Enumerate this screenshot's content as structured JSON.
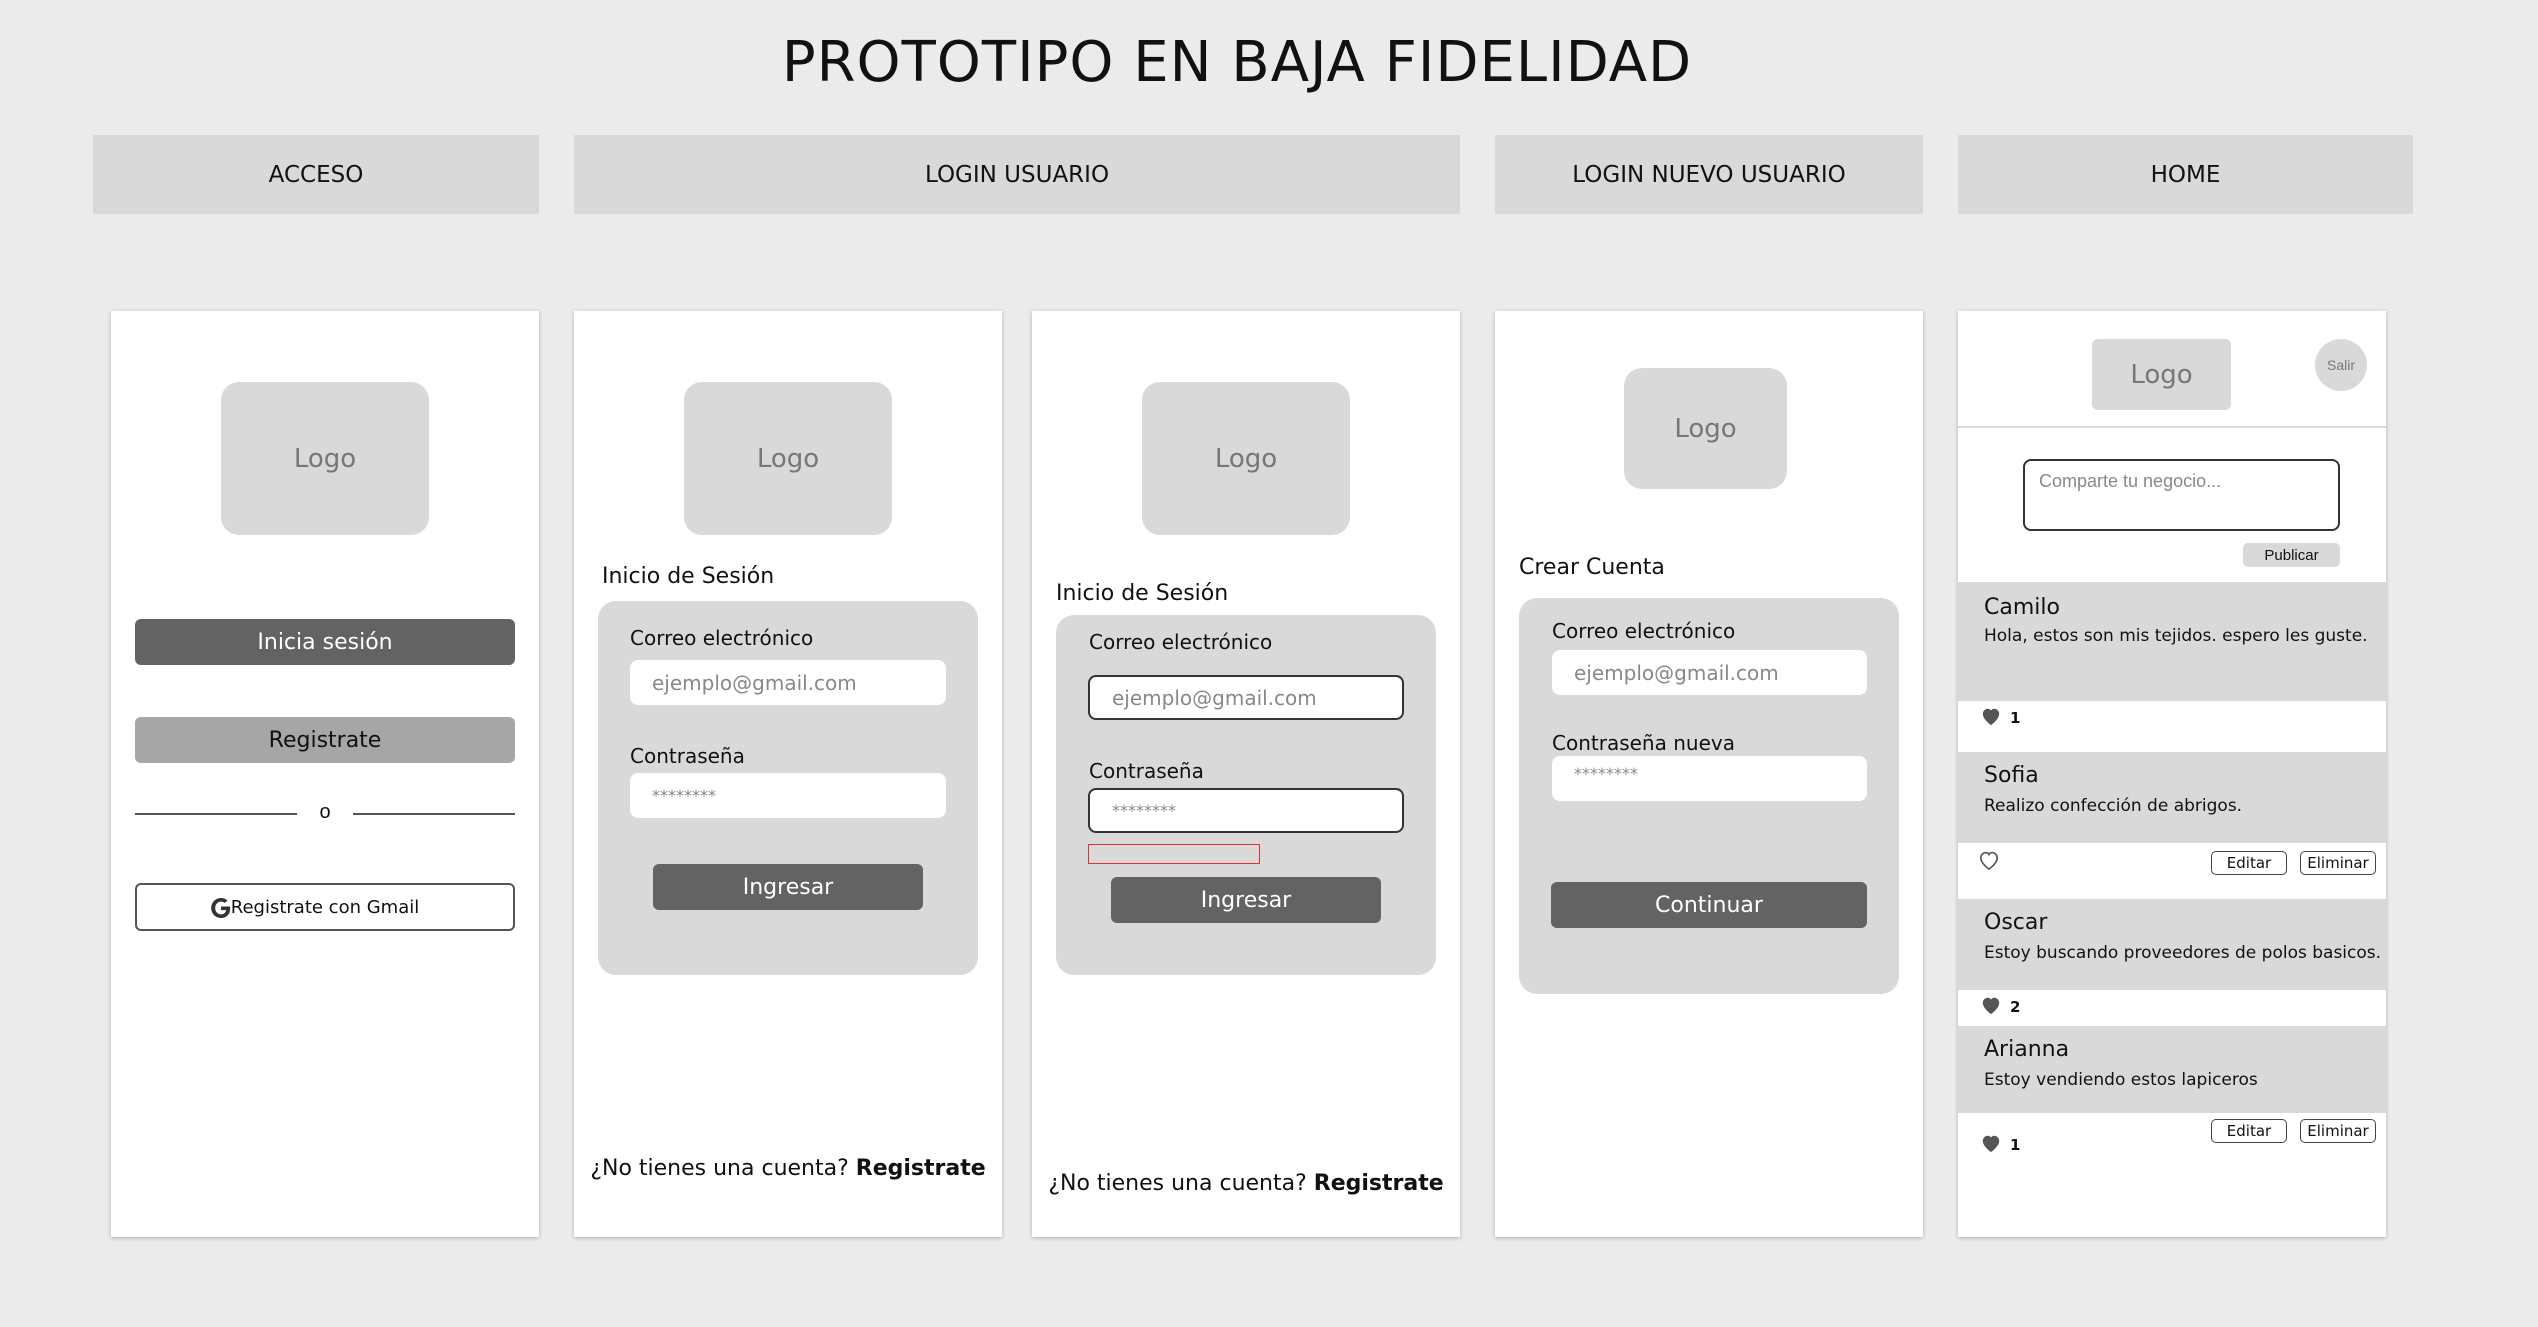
{
  "page": {
    "title": "PROTOTIPO EN BAJA FIDELIDAD"
  },
  "headers": [
    "ACCESO",
    "LOGIN USUARIO",
    "LOGIN NUEVO USUARIO",
    "HOME"
  ],
  "logo_label": "Logo",
  "acceso": {
    "login_button": "Inicia sesión",
    "register_button": "Registrate",
    "separator": "o",
    "gmail_button": "Registrate con Gmail"
  },
  "login": {
    "section_title": "Inicio de Sesión",
    "email_label": "Correo electrónico",
    "email_placeholder": "ejemplo@gmail.com",
    "password_label": "Contraseña",
    "password_value": "********",
    "submit": "Ingresar",
    "footer_question": "¿No tienes una cuenta?",
    "footer_link": "Registrate"
  },
  "signup": {
    "section_title": "Crear Cuenta",
    "email_label": "Correo electrónico",
    "email_placeholder": "ejemplo@gmail.com",
    "password_label": "Contraseña nueva",
    "password_value": "********",
    "submit": "Continuar"
  },
  "home": {
    "logout": "Salir",
    "share_placeholder": "Comparte tu negocio...",
    "publish": "Publicar",
    "edit": "Editar",
    "delete": "Eliminar",
    "posts": [
      {
        "name": "Camilo",
        "text": "Hola, estos son mis tejidos. espero les guste.",
        "likes": "1"
      },
      {
        "name": "Sofia",
        "text": "Realizo confección de abrigos."
      },
      {
        "name": "Oscar",
        "text": "Estoy buscando proveedores de polos basicos.",
        "likes": "2"
      },
      {
        "name": "Arianna",
        "text": "Estoy vendiendo estos lapiceros",
        "likes": "1"
      }
    ]
  },
  "colors": {
    "background": "#ecebec",
    "panel": "#d9d9d9",
    "button_dark": "#636363",
    "button_gray": "#a6a6a6",
    "error_outline": "#e03030"
  }
}
